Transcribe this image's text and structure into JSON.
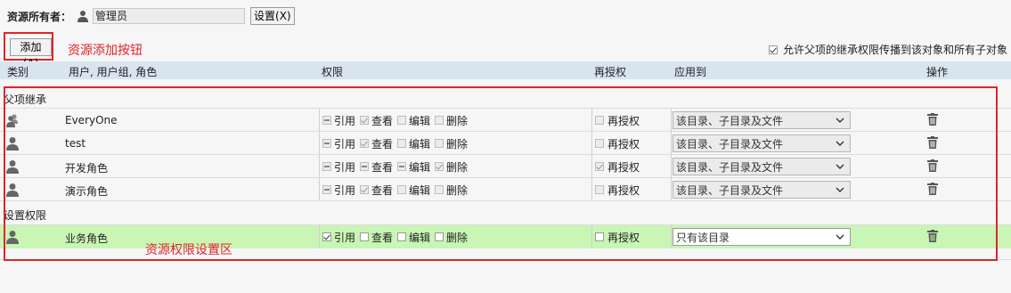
{
  "owner": {
    "label": "资源所有者：",
    "value": "管理员",
    "set_button": "设置(X)"
  },
  "toolbar": {
    "add_button": "添加(A)",
    "add_annotation": "资源添加按钮"
  },
  "inherit_option": {
    "label": "允许父项的继承权限传播到该对象和所有子对象",
    "checked": true
  },
  "table": {
    "headers": {
      "type": "类别",
      "users": "用户, 用户组, 角色",
      "permission": "权限",
      "regrant": "再授权",
      "apply_to": "应用到",
      "action": "操作"
    },
    "sections": {
      "inherited": "父项继承",
      "set": "设置权限"
    },
    "perm_labels": {
      "ref": "引用",
      "view": "查看",
      "edit": "编辑",
      "delete": "删除",
      "regrant": "再授权"
    },
    "inherited_rows": [
      {
        "name": "EveryOne",
        "icon": "group-icon",
        "apply": "该目录、子目录及文件"
      },
      {
        "name": "test",
        "icon": "user-icon",
        "apply": "该目录、子目录及文件"
      },
      {
        "name": "开发角色",
        "icon": "user-icon",
        "apply": "该目录、子目录及文件"
      },
      {
        "name": "演示角色",
        "icon": "user-icon",
        "apply": "该目录、子目录及文件"
      }
    ],
    "set_rows": [
      {
        "name": "业务角色",
        "icon": "user-icon",
        "apply": "只有该目录"
      }
    ]
  },
  "region_annotation": "资源权限设置区",
  "colors": {
    "accent_red": "#e2232a",
    "header_bg": "#d9e4f1",
    "selected_row": "#c9f5b5"
  }
}
